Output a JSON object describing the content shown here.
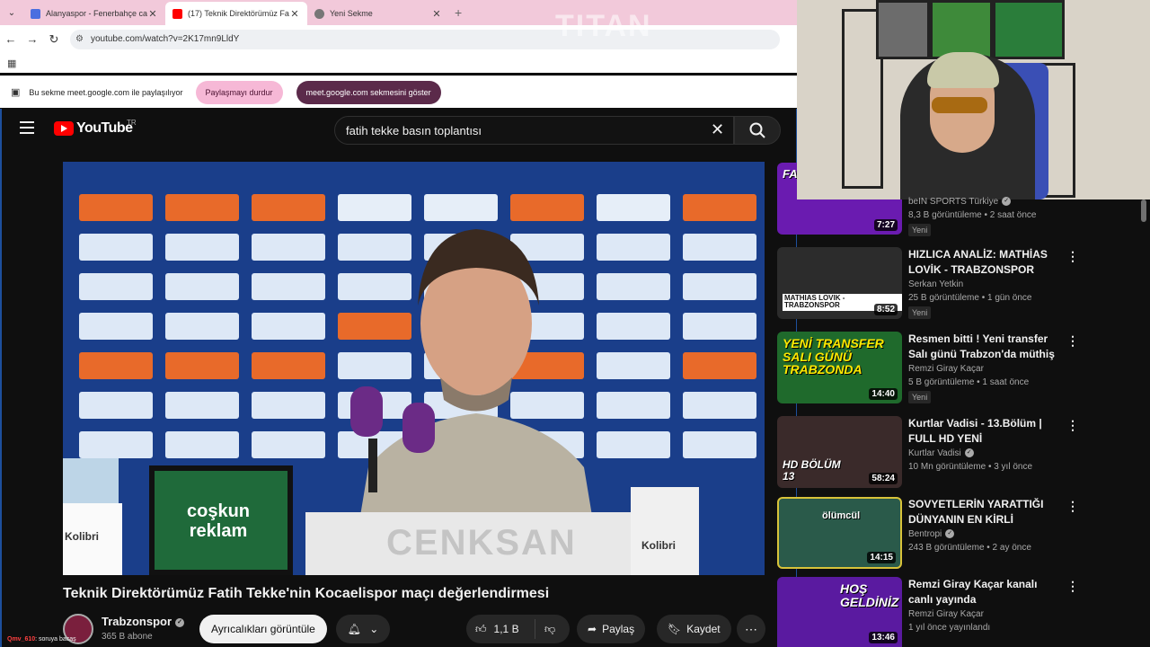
{
  "browser": {
    "tabs": [
      {
        "title": "Alanyaspor - Fenerbahçe canlı ...",
        "active": false
      },
      {
        "title": "(17) Teknik Direktörümüz Fa...",
        "active": true
      },
      {
        "title": "Yeni Sekme",
        "active": false
      }
    ],
    "url": "youtube.com/watch?v=2K17mn9LldY",
    "share_bar": {
      "text": "Bu sekme meet.google.com ile paylaşılıyor",
      "stop_label": "Paylaşmayı durdur",
      "show_label": "meet.google.com sekmesini göster"
    }
  },
  "watermark": "TITAN",
  "youtube": {
    "logo_text": "YouTube",
    "country": "TR",
    "search_query": "fatih tekke basın toplantısı",
    "video": {
      "title": "Teknik Direktörümüz Fatih Tekke'nin Kocaelispor maçı değerlendirmesi",
      "channel": "Trabzonspor",
      "subscribers": "365 B abone",
      "join_label": "Ayrıcalıkları görüntüle",
      "likes": "1,1 B",
      "share_label": "Paylaş",
      "save_label": "Kaydet",
      "backdrop_texts": [
        "coşkun reklam",
        "CENKSAN",
        "Kolibri",
        "Kolibri"
      ]
    },
    "recommendations": [
      {
        "title": "",
        "channel": "beIN SPORTS Türkiye",
        "meta": "8,3 B görüntüleme • 2 saat önce",
        "badge": "Yeni",
        "duration": "7:27",
        "thumb_text": "FA TEKKE",
        "thumb_color": "#6a1bb0"
      },
      {
        "title": "HIZLICA ANALİZ: MATHİAS LOVİK - TRABZONSPOR",
        "channel": "Serkan Yetkin",
        "meta": "25 B görüntüleme • 1 gün önce",
        "badge": "Yeni",
        "duration": "8:52",
        "thumb_text": "MATHIAS LOVIK - TRABZONSPOR",
        "thumb_color": "#2c2c2c"
      },
      {
        "title": "Resmen bitti ! Yeni transfer Salı günü Trabzon'da müthiş habe...",
        "channel": "Remzi Giray Kaçar",
        "meta": "5 B görüntüleme • 1 saat önce",
        "badge": "Yeni",
        "duration": "14:40",
        "thumb_text": "YENİ TRANSFER SALI GÜNÜ TRABZONDA",
        "thumb_color": "#1f6a2c"
      },
      {
        "title": "Kurtlar Vadisi - 13.Bölüm | FULL HD YENİ",
        "channel": "Kurtlar Vadisi",
        "meta": "10 Mn görüntüleme • 3 yıl önce",
        "badge": "",
        "duration": "58:24",
        "thumb_text": "HD BÖLÜM 13",
        "thumb_color": "#3a2a2a"
      },
      {
        "title": "SOVYETLERİN YARATTIĞI DÜNYANIN EN KİRLİ NOKTASI",
        "channel": "Bentropi",
        "meta": "243 B görüntüleme • 2 ay önce",
        "badge": "",
        "duration": "14:15",
        "thumb_text": "ölümcül",
        "thumb_color": "#2a5a4a"
      },
      {
        "title": "Remzi Giray Kaçar kanalı canlı yayında",
        "channel": "Remzi Giray Kaçar",
        "meta": "1 yıl önce yayınlandı",
        "badge": "",
        "duration": "13:46",
        "thumb_text": "HOŞ GELDİNİZ",
        "thumb_color": "#5a1aa0"
      }
    ]
  },
  "chat_overlay": {
    "user": "Qmv_610",
    "message": ": soruya bacaş"
  },
  "colors": {
    "accent": "#ff0000",
    "tabstrip": "#f2c9da",
    "share_stop": "#f6b8d6",
    "share_show": "#5b2a4a"
  }
}
